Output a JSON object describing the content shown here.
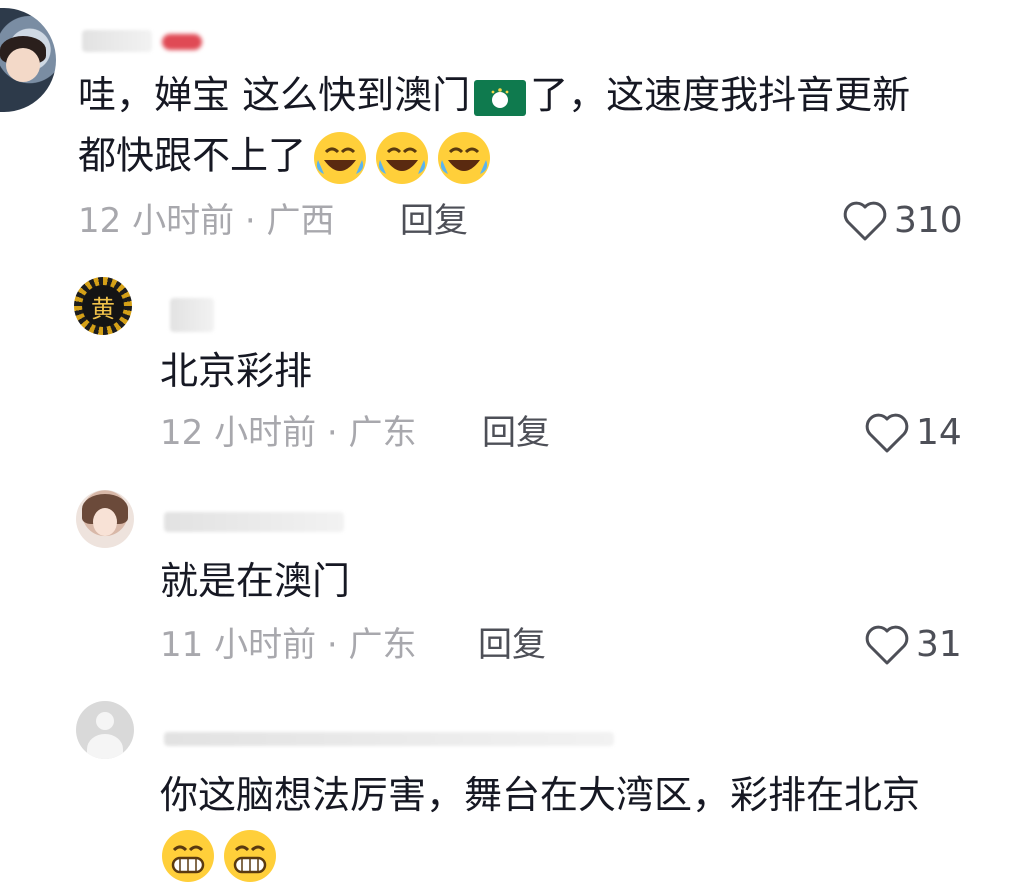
{
  "comments": [
    {
      "text_line1": "哇，婵宝  这么快到澳门",
      "text_line1_after": "了，这速度我抖音更新",
      "text_line2": "都快跟不上了",
      "meta": "12 小时前 · 广西",
      "reply": "回复",
      "likes": "310",
      "emojis": [
        "laugh-cry-emoji",
        "laugh-cry-emoji",
        "laugh-cry-emoji"
      ],
      "flag": "macau-flag"
    },
    {
      "avatar_text": "黄",
      "text": "北京彩排",
      "meta": "12 小时前 · 广东",
      "reply": "回复",
      "likes": "14"
    },
    {
      "text": "就是在澳门",
      "meta": "11 小时前 · 广东",
      "reply": "回复",
      "likes": "31"
    },
    {
      "text": "你这脑想法厉害，舞台在大湾区，彩排在北京",
      "meta": "",
      "emojis": [
        "grin-emoji",
        "grin-emoji"
      ]
    }
  ],
  "colors": {
    "text": "#161823",
    "meta": "#a8a8ad",
    "action": "#4d4f57"
  }
}
